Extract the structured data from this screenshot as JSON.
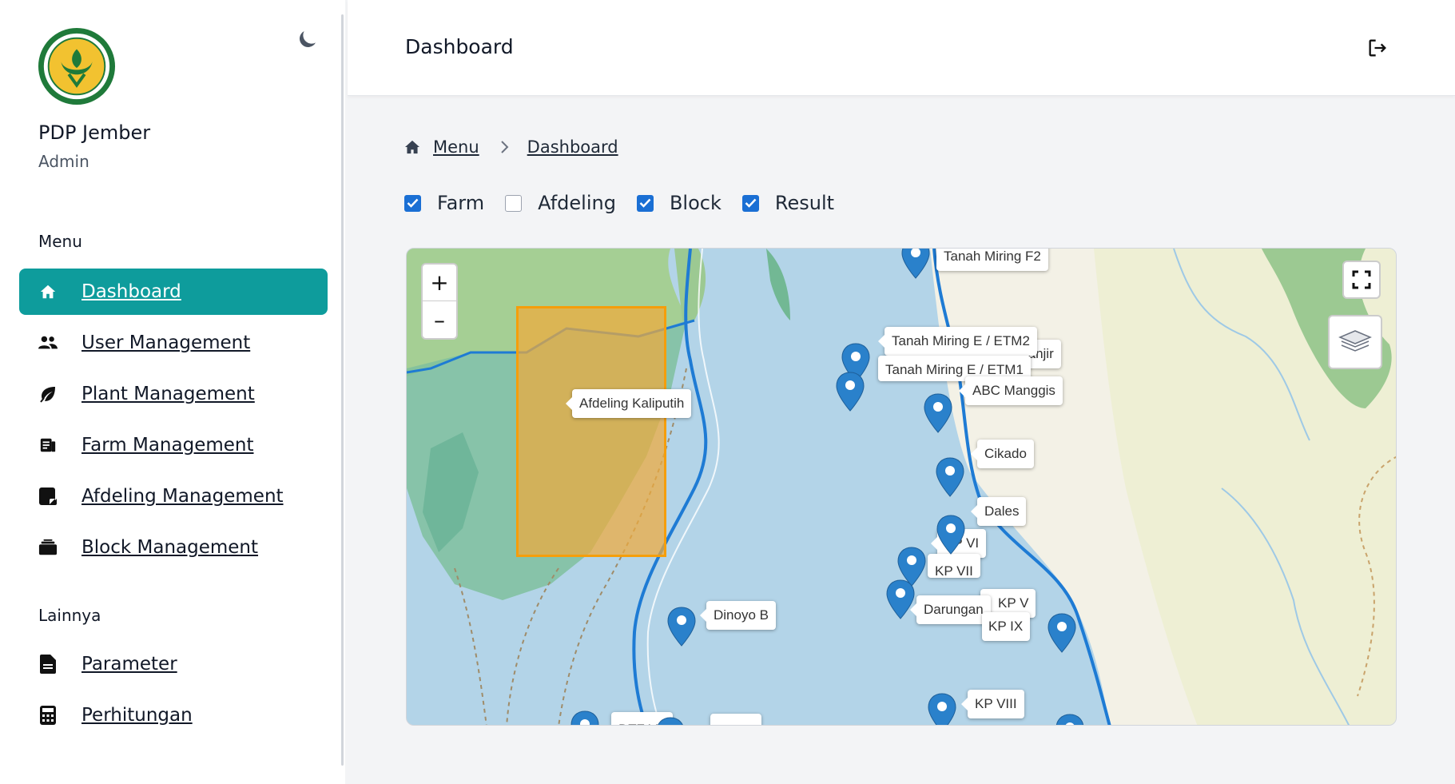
{
  "sidebar": {
    "org_name": "PDP Jember",
    "org_role": "Admin",
    "menu_title": "Menu",
    "menu_items": [
      {
        "label": "Dashboard",
        "icon": "home-icon",
        "active": true
      },
      {
        "label": "User Management",
        "icon": "users-icon"
      },
      {
        "label": "Plant Management",
        "icon": "leaf-icon"
      },
      {
        "label": "Farm Management",
        "icon": "farm-icon"
      },
      {
        "label": "Afdeling Management",
        "icon": "note-icon"
      },
      {
        "label": "Block Management",
        "icon": "box-icon"
      }
    ],
    "other_title": "Lainnya",
    "other_items": [
      {
        "label": "Parameter",
        "icon": "file-icon"
      },
      {
        "label": "Perhitungan",
        "icon": "calculator-icon"
      }
    ]
  },
  "header": {
    "title": "Dashboard"
  },
  "breadcrumb": {
    "items": [
      "Menu",
      "Dashboard"
    ]
  },
  "layers": [
    {
      "label": "Farm",
      "checked": true
    },
    {
      "label": "Afdeling",
      "checked": false
    },
    {
      "label": "Block",
      "checked": true
    },
    {
      "label": "Result",
      "checked": true
    }
  ],
  "map": {
    "zoom_in": "+",
    "zoom_out": "–",
    "afdeling_label": "Afdeling Kaliputih",
    "markers": [
      {
        "label": "Tanah Miring F2"
      },
      {
        "label": "Tanah Miring E / ETM2"
      },
      {
        "label": "Tanah Miring E / ETM1"
      },
      {
        "label": "Ex. Banjir"
      },
      {
        "label": "ABC Manggis"
      },
      {
        "label": "Cikado"
      },
      {
        "label": "Dales"
      },
      {
        "label": "KP VI"
      },
      {
        "label": "KP VII"
      },
      {
        "label": "Darungan"
      },
      {
        "label": "KP V"
      },
      {
        "label": "KP IX"
      },
      {
        "label": "Dinoyo B"
      },
      {
        "label": "KP VIII"
      },
      {
        "label": "DTZ VII"
      }
    ]
  }
}
